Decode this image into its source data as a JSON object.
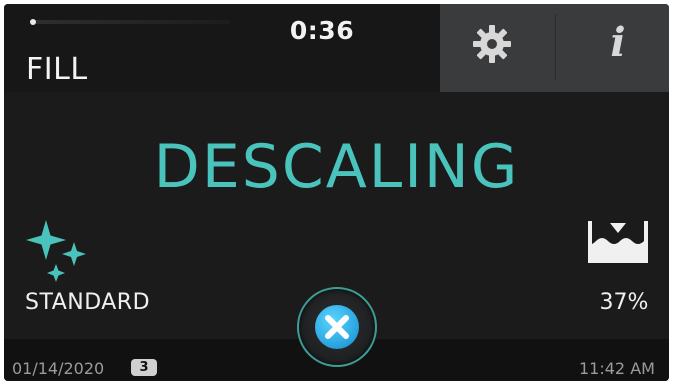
{
  "header": {
    "timer": "0:36",
    "phase": "FILL",
    "progress": 0.02,
    "settings_icon": "gear-icon",
    "info_icon": "info-icon",
    "info_glyph": "i"
  },
  "main": {
    "title": "DESCALING"
  },
  "mode": {
    "icon": "sparkle-icon",
    "label": "STANDARD"
  },
  "tank": {
    "icon": "water-level-icon",
    "percent": "37%"
  },
  "footer": {
    "date": "01/14/2020",
    "badge": "3",
    "time": "11:42 AM"
  },
  "cancel": {
    "icon": "close-icon"
  },
  "colors": {
    "accent": "#49c3bb",
    "cancel_blue": "#2ea9e3",
    "background": "#1b1b1c"
  }
}
